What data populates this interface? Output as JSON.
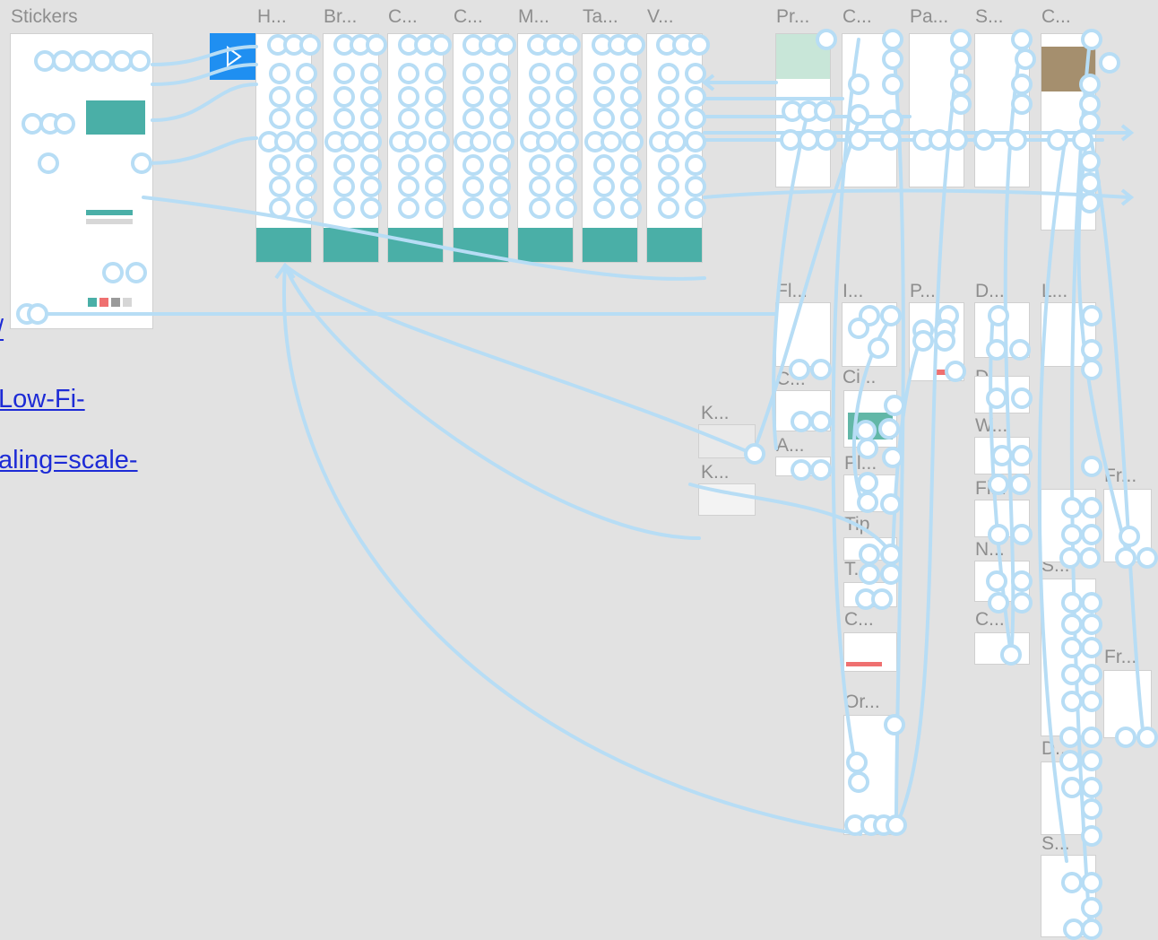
{
  "labels": {
    "stickers": "Stickers",
    "h": "H...",
    "br": "Br...",
    "c1": "C...",
    "c2": "C...",
    "m": "M...",
    "ta": "Ta...",
    "v": "V...",
    "pr": "Pr...",
    "c3": "C...",
    "pa": "Pa...",
    "s": "S...",
    "c4": "C...",
    "fl": "Fl...",
    "ii": "I...",
    "p": "P...",
    "d": "D...",
    "ll": "L...",
    "ci": "C...",
    "w": "W...",
    "ci2": "Ci...",
    "k1": "K...",
    "a": "A...",
    "pl": "Pl...",
    "fi": "Fi...",
    "k2": "K...",
    "tip": "Tip",
    "n": "N...",
    "fr1": "Fr...",
    "t": "T...",
    "s2": "S...",
    "c5": "C...",
    "c6": "C...",
    "or": "Or...",
    "fr2": "Fr...",
    "d2": "D...",
    "s3": "S..."
  },
  "links": {
    "link1": "/",
    "link2": "Low-Fi-",
    "link3": "aling=scale-"
  },
  "play_button_icon": "play-icon",
  "colors": {
    "canvas": "#e2e2e2",
    "connector": "#b7ddf5",
    "teal": "#4aafa7",
    "play": "#1f8ff1",
    "link": "#1d2bd6",
    "label": "#8e8e8e"
  }
}
